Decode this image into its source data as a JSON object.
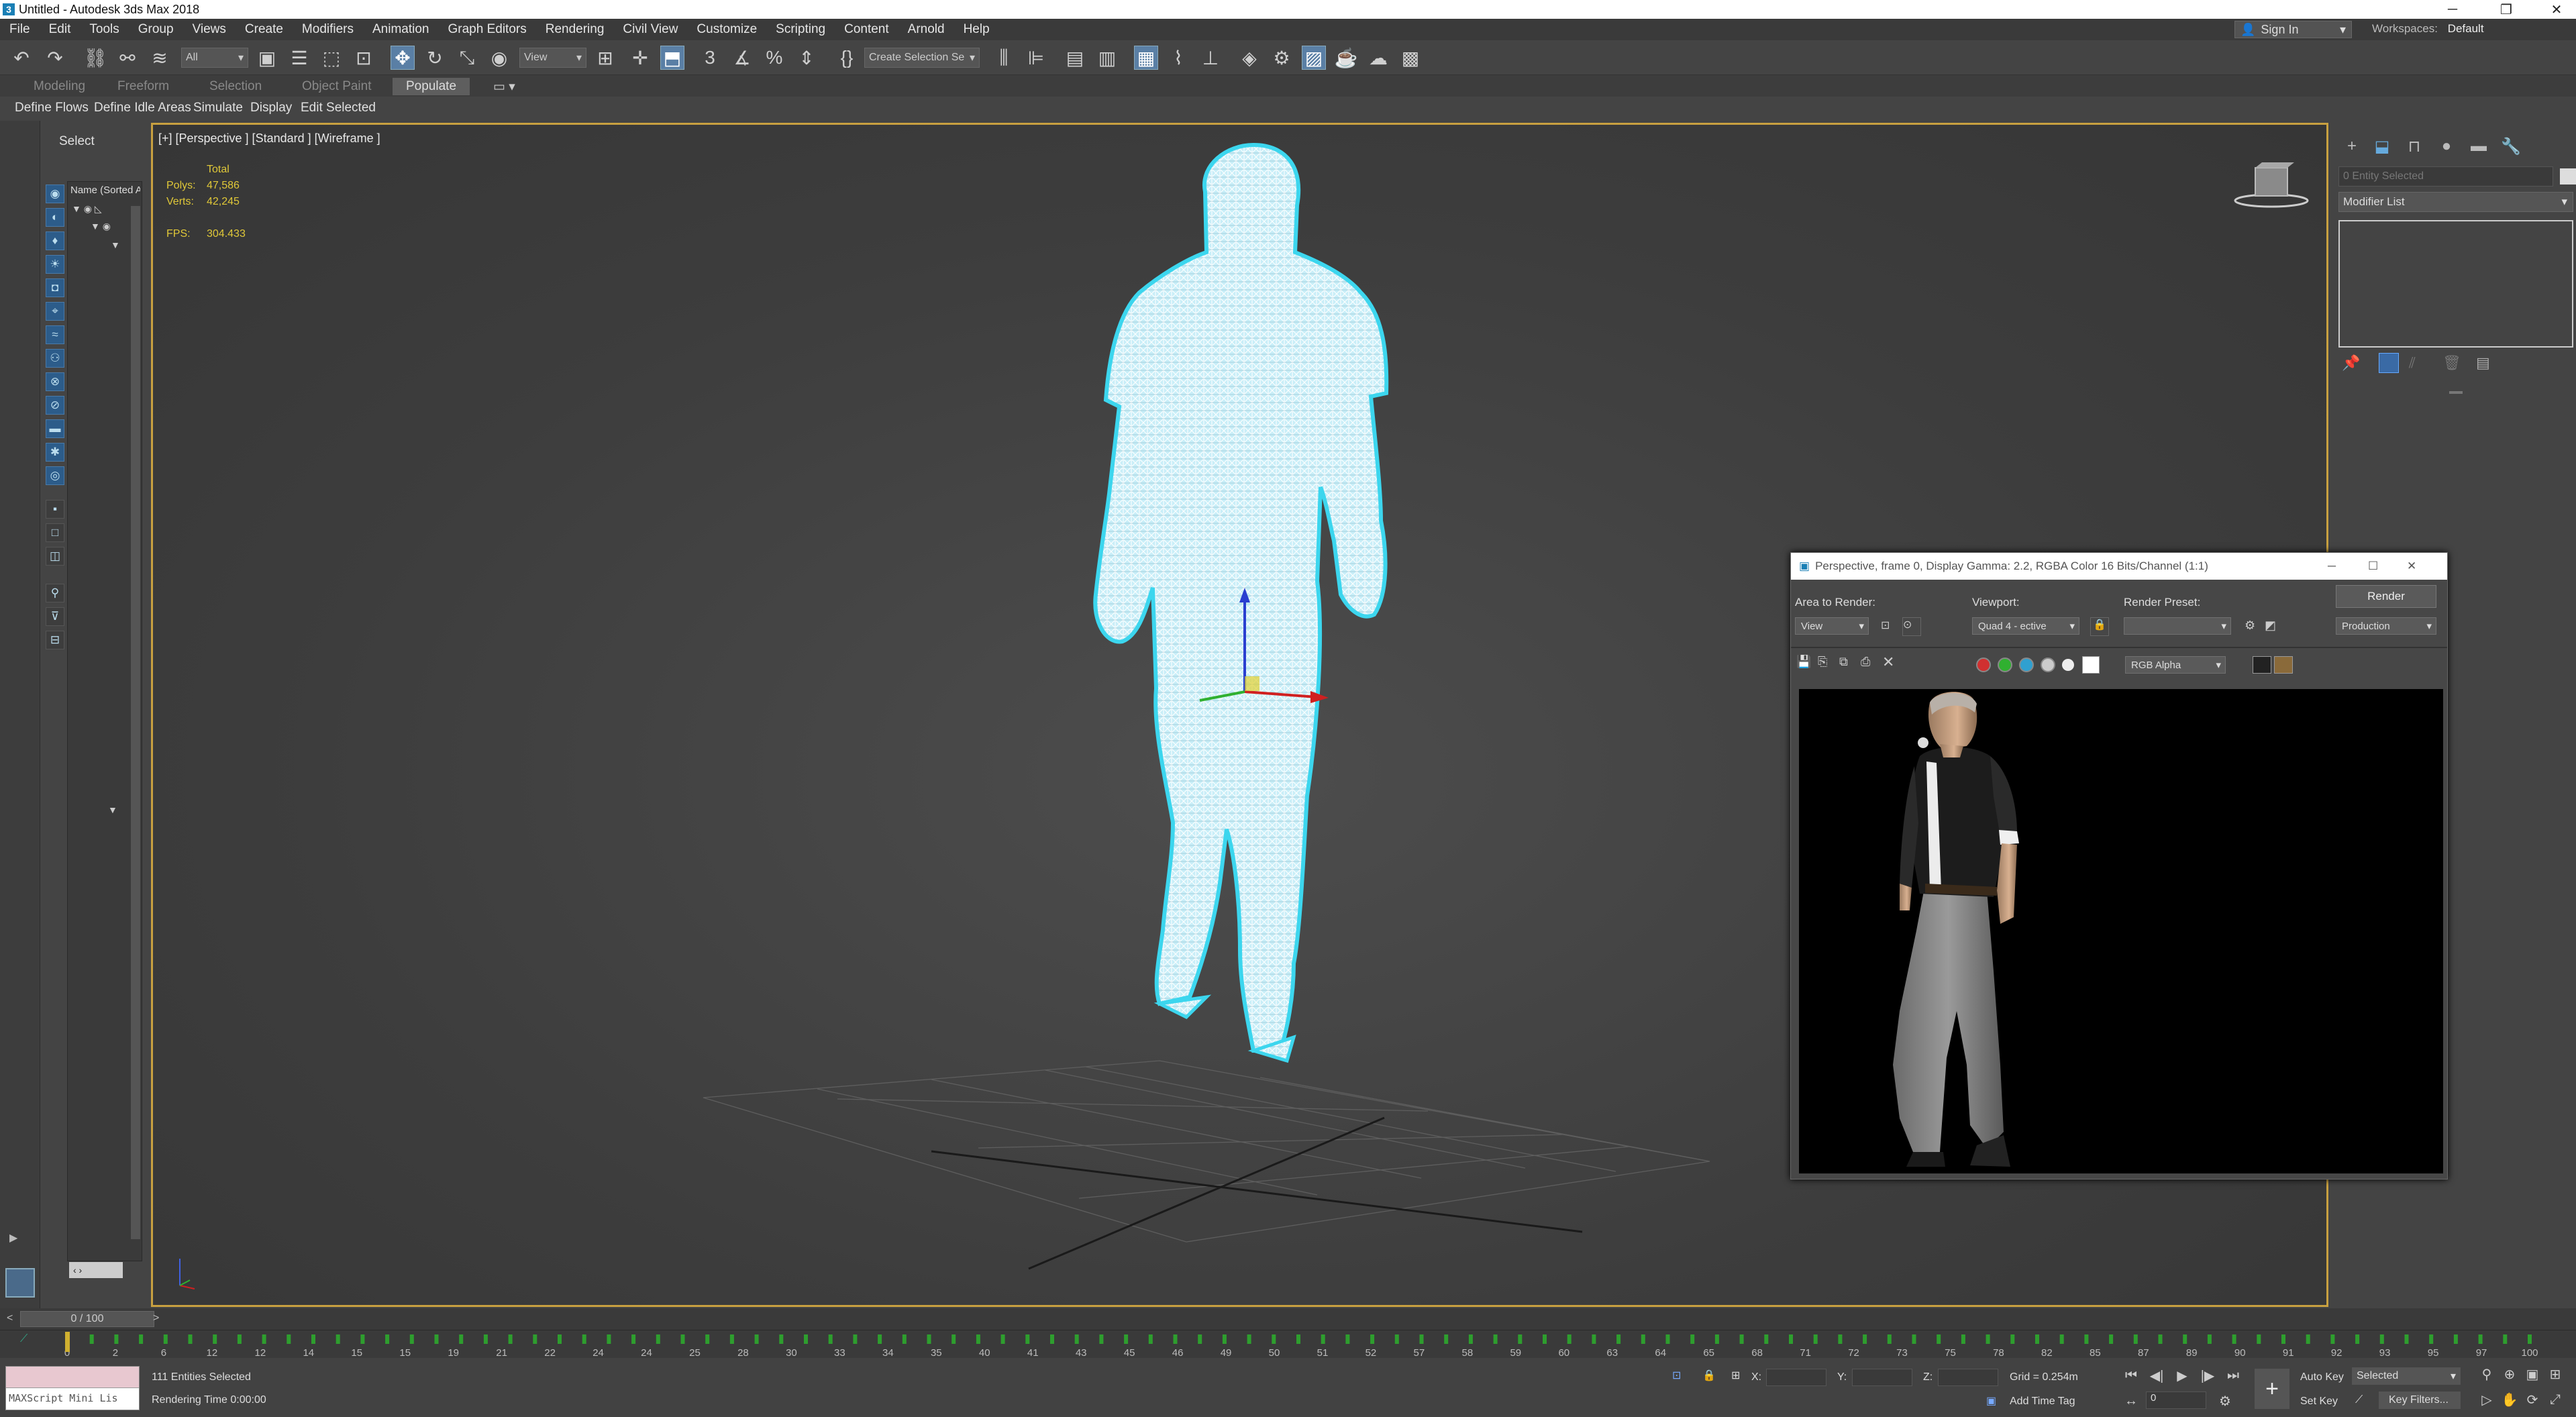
{
  "app": {
    "title": "Untitled - Autodesk 3ds Max 2018",
    "logo_letter": "3"
  },
  "window_controls": {
    "minimize": "─",
    "restore": "❐",
    "close": "✕"
  },
  "menu": [
    "File",
    "Edit",
    "Tools",
    "Group",
    "Views",
    "Create",
    "Modifiers",
    "Animation",
    "Graph Editors",
    "Rendering",
    "Civil View",
    "Customize",
    "Scripting",
    "Content",
    "Arnold",
    "Help"
  ],
  "account": {
    "sign_in": "Sign In",
    "workspaces_label": "Workspaces:",
    "workspace": "Default"
  },
  "toolbar": {
    "selection_filter": "All",
    "ref_coord": "View",
    "selection_set": "Create Selection Se"
  },
  "ribbon": {
    "tabs": [
      "Modeling",
      "Freeform",
      "Selection",
      "Object Paint",
      "Populate"
    ],
    "active_tab": "Populate",
    "panel_buttons": [
      "Define Flows",
      "Define Idle Areas",
      "Simulate",
      "Display",
      "Edit Selected"
    ]
  },
  "scene_explorer": {
    "select_label": "Select",
    "column_header": "Name (Sorted A"
  },
  "viewport": {
    "label": "[+] [Perspective ] [Standard ] [Wireframe ]",
    "stats": {
      "total_label": "Total",
      "polys_label": "Polys:",
      "polys": "47,586",
      "verts_label": "Verts:",
      "verts": "42,245",
      "fps_label": "FPS:",
      "fps": "304.433"
    },
    "wire_color": "#e0f6ff",
    "selection_outline_color": "#3cd6ee"
  },
  "command_panel": {
    "entity_field": "0 Entity Selected",
    "modifier_list": "Modifier List"
  },
  "render_window": {
    "title": "Perspective, frame 0, Display Gamma: 2.2, RGBA Color 16 Bits/Channel (1:1)",
    "area_to_render_label": "Area to Render:",
    "area_to_render": "View",
    "viewport_label": "Viewport:",
    "viewport": "Quad 4 - ective",
    "render_preset_label": "Render Preset:",
    "render_preset": "",
    "render_button": "Render",
    "production": "Production",
    "channel": "RGB Alpha"
  },
  "time": {
    "slider": "0 / 100",
    "ticks": [
      "0",
      "2",
      "6",
      "12",
      "12",
      "14",
      "15",
      "15",
      "19",
      "21",
      "22",
      "24",
      "24",
      "25",
      "28",
      "30",
      "33",
      "34",
      "35",
      "40",
      "41",
      "43",
      "45",
      "46",
      "49",
      "50",
      "51",
      "52",
      "57",
      "58",
      "59",
      "60",
      "63",
      "64",
      "65",
      "68",
      "71",
      "72",
      "73",
      "75",
      "78",
      "82",
      "85",
      "87",
      "89",
      "90",
      "91",
      "92",
      "93",
      "95",
      "97",
      "100"
    ]
  },
  "status": {
    "maxscript_placeholder": "MAXScript Mini Lis",
    "entities": "111 Entities Selected",
    "render_time": "Rendering Time  0:00:00",
    "x_label": "X:",
    "y_label": "Y:",
    "z_label": "Z:",
    "grid": "Grid = 0.254m",
    "add_time_tag": "Add Time Tag",
    "auto_key": "Auto Key",
    "selected": "Selected",
    "set_key": "Set Key",
    "key_filters": "Key Filters...",
    "frame": "0"
  }
}
